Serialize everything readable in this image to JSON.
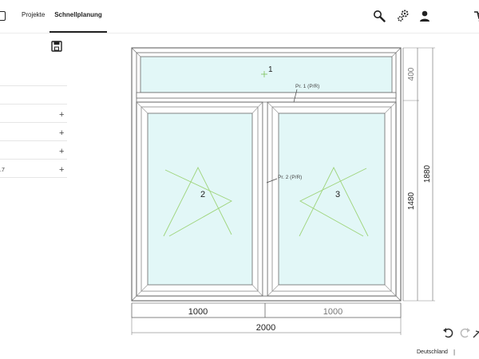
{
  "nav": {
    "tabs": [
      {
        "label": "Projekte"
      },
      {
        "label": "Schnellplanung"
      }
    ]
  },
  "sidebar": {
    "rows": [
      {
        "label": ""
      },
      {
        "label": ""
      },
      {
        "label": ""
      },
      {
        "label": ".7"
      }
    ]
  },
  "drawing": {
    "sash_labels": [
      "1",
      "2",
      "3"
    ],
    "profile_labels": [
      "Pr. 1 (P/R)",
      "Pr. 2 (P/R)"
    ],
    "dimensions": {
      "col_left": "1000",
      "col_right": "1000",
      "total_width": "2000",
      "top_height": "400",
      "bottom_height": "1480",
      "total_height": "1880"
    }
  },
  "footer": {
    "language": "Deutschland",
    "separator": "|"
  },
  "colors": {
    "glass": "#e2f7f7",
    "frame": "#555555",
    "opening_marks": "#9ed47a",
    "dimension_text_muted": "#777777"
  }
}
